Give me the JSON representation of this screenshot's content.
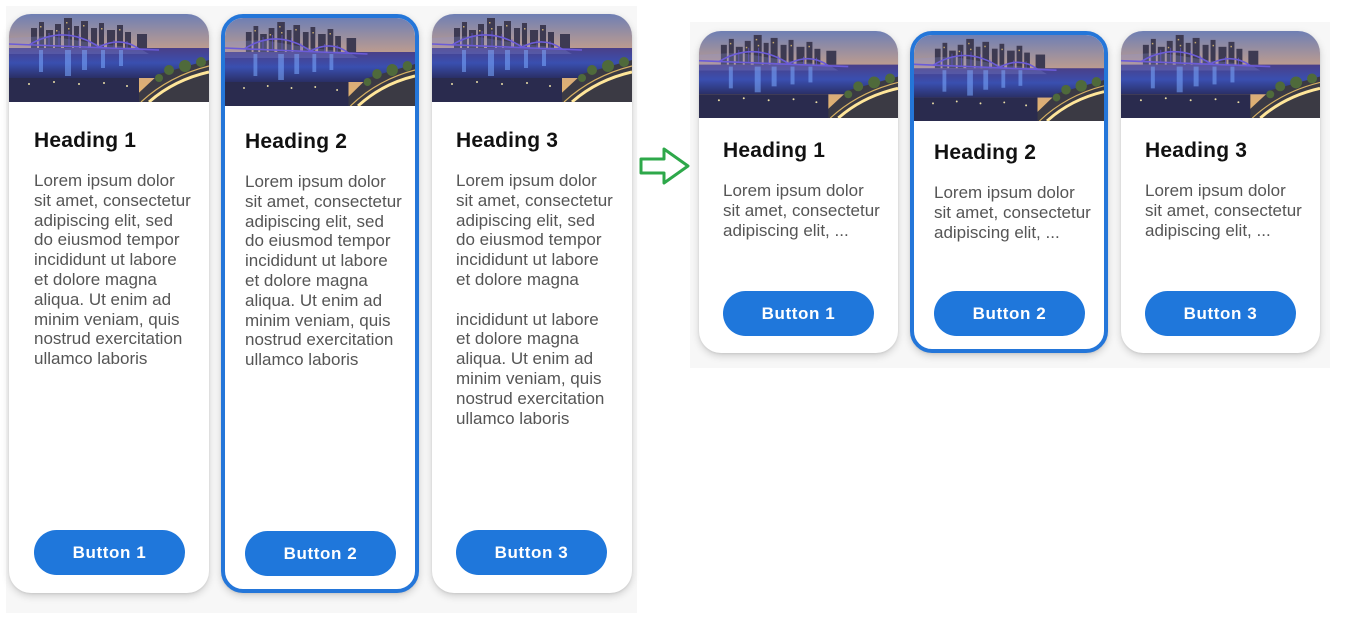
{
  "colors": {
    "accent": "#1f77db",
    "selected_border": "#2476d9",
    "arrow": "#2ea84a"
  },
  "icons": {
    "transition": "right-arrow-icon",
    "card_image": "city-bridge-night-photo"
  },
  "before": {
    "cards": [
      {
        "heading": "Heading 1",
        "paragraphs": [
          "Lorem ipsum dolor sit amet, consectetur adipiscing elit, sed do eiusmod tempor incididunt ut labore et dolore magna aliqua. Ut enim ad minim veniam, quis nostrud exercitation ullamco laboris"
        ],
        "button": "Button 1",
        "selected": false
      },
      {
        "heading": "Heading 2",
        "paragraphs": [
          "Lorem ipsum dolor sit amet, consectetur adipiscing elit, sed do eiusmod tempor incididunt ut labore et dolore magna aliqua. Ut enim ad minim veniam, quis nostrud exercitation ullamco laboris"
        ],
        "button": "Button 2",
        "selected": true
      },
      {
        "heading": "Heading 3",
        "paragraphs": [
          "Lorem ipsum dolor sit amet, consectetur adipiscing elit, sed do eiusmod tempor incididunt ut labore et dolore magna",
          "incididunt ut labore et dolore magna aliqua. Ut enim ad minim veniam, quis nostrud exercitation ullamco laboris"
        ],
        "button": "Button 3",
        "selected": false
      }
    ]
  },
  "after": {
    "cards": [
      {
        "heading": "Heading 1",
        "text": "Lorem ipsum dolor sit amet, consectetur adipiscing elit, ...",
        "button": "Button 1",
        "selected": false
      },
      {
        "heading": "Heading 2",
        "text": "Lorem ipsum dolor sit amet, consectetur adipiscing elit, ...",
        "button": "Button 2",
        "selected": true
      },
      {
        "heading": "Heading 3",
        "text": "Lorem ipsum dolor sit amet, consectetur adipiscing elit, ...",
        "button": "Button 3",
        "selected": false
      }
    ]
  }
}
